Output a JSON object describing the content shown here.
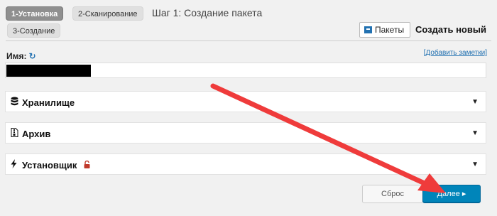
{
  "steps": [
    {
      "label": "1-Установка"
    },
    {
      "label": "2-Сканирование"
    },
    {
      "label": "3-Создание"
    }
  ],
  "step_title": "Шаг 1: Создание пакета",
  "header": {
    "packages_label": "Пакеты",
    "create_new_label": "Создать новый"
  },
  "form": {
    "name_label": "Имя:",
    "refresh_icon_glyph": "↻",
    "add_notes_label": "[Добавить заметки]",
    "name_value": ""
  },
  "panels": [
    {
      "label": "Хранилище",
      "icon": "database-icon"
    },
    {
      "label": "Архив",
      "icon": "archive-file-icon"
    },
    {
      "label": "Установщик",
      "icon": "bolt-icon",
      "lock_icon": "unlock-icon"
    }
  ],
  "buttons": {
    "reset_label": "Сброс",
    "next_label": "Далее ▸"
  },
  "colors": {
    "primary": "#0085ba",
    "link": "#2271b1",
    "annotation_arrow": "#ef3b3b",
    "lock": "#c0392b"
  }
}
